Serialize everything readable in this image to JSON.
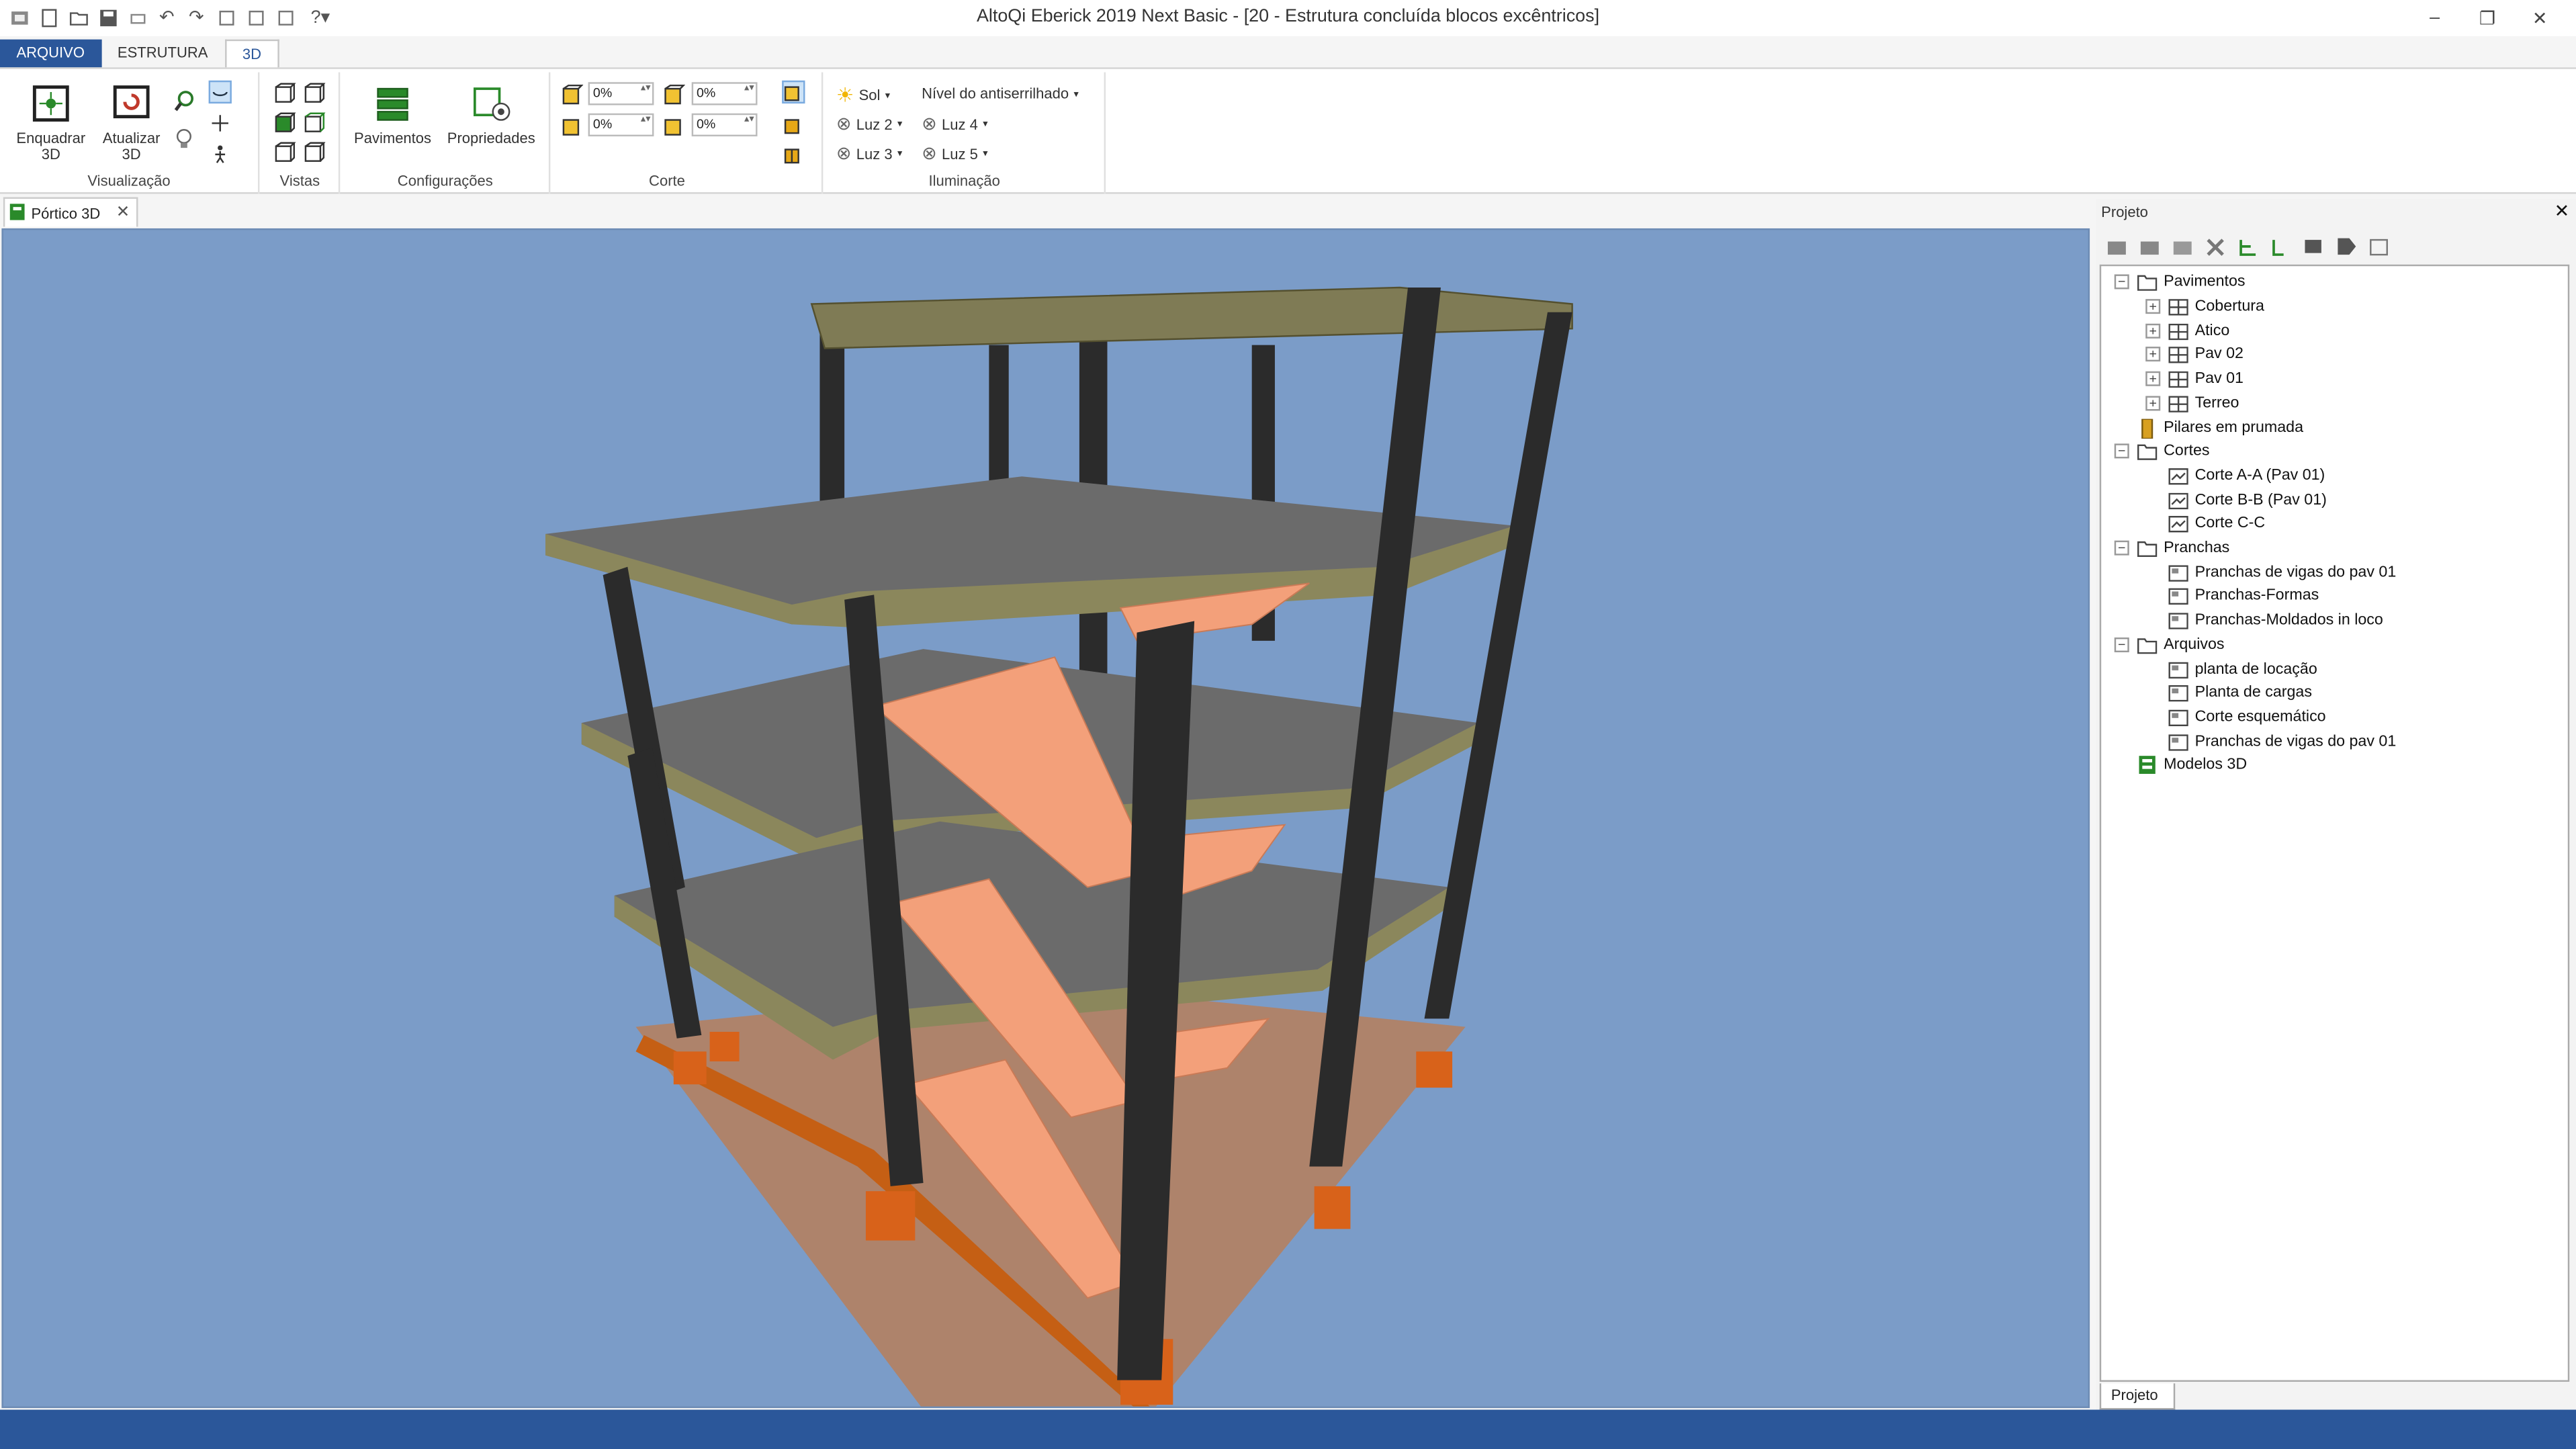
{
  "window": {
    "title": "AltoQi Eberick 2019 Next Basic - [20 - Estrutura concluída blocos excêntricos]"
  },
  "ribbon_tabs": [
    "ARQUIVO",
    "ESTRUTURA",
    "3D"
  ],
  "ribbon": {
    "visualizacao": {
      "label": "Visualização",
      "enquadrar": "Enquadrar\n3D",
      "enquadrar_l1": "Enquadrar",
      "enquadrar_l2": "3D",
      "atualizar_l1": "Atualizar",
      "atualizar_l2": "3D"
    },
    "vistas": {
      "label": "Vistas"
    },
    "configuracoes": {
      "label": "Configurações",
      "pavimentos": "Pavimentos",
      "propriedades": "Propriedades"
    },
    "corte": {
      "label": "Corte",
      "values": [
        "0%",
        "0%",
        "0%",
        "0%"
      ]
    },
    "iluminacao": {
      "label": "Iluminação",
      "sol": "Sol",
      "nivel": "Nível do antiserrilhado",
      "luz2": "Luz 2",
      "luz3": "Luz 3",
      "luz4": "Luz 4",
      "luz5": "Luz 5"
    }
  },
  "document_tab": "Pórtico 3D",
  "panel": {
    "title": "Projeto",
    "bottom_tab": "Projeto",
    "tree": {
      "pavimentos": "Pavimentos",
      "cobertura": "Cobertura",
      "atico": "Atico",
      "pav02": "Pav 02",
      "pav01": "Pav 01",
      "terreo": "Terreo",
      "pilares": "Pilares em prumada",
      "cortes": "Cortes",
      "corte_aa": "Corte A-A (Pav 01)",
      "corte_bb": "Corte B-B (Pav 01)",
      "corte_cc": "Corte C-C",
      "pranchas": "Pranchas",
      "pr_vigas": "Pranchas de vigas do pav 01",
      "pr_formas": "Pranchas-Formas",
      "pr_moldados": "Pranchas-Moldados in loco",
      "arquivos": "Arquivos",
      "planta_locacao": "planta de locação",
      "planta_cargas": "Planta de cargas",
      "corte_esquematico": "Corte esquemático",
      "arq_vigas": "Pranchas de vigas do pav 01",
      "modelos3d": "Modelos 3D"
    }
  },
  "colors": {
    "accent": "#2b579a",
    "viewport_bg": "#7b9cc8",
    "slab": "#6e6e6e",
    "beam": "#7f7b55",
    "column": "#2b2b2b",
    "stair": "#f3a07a",
    "foundation": "#d86b1a"
  }
}
